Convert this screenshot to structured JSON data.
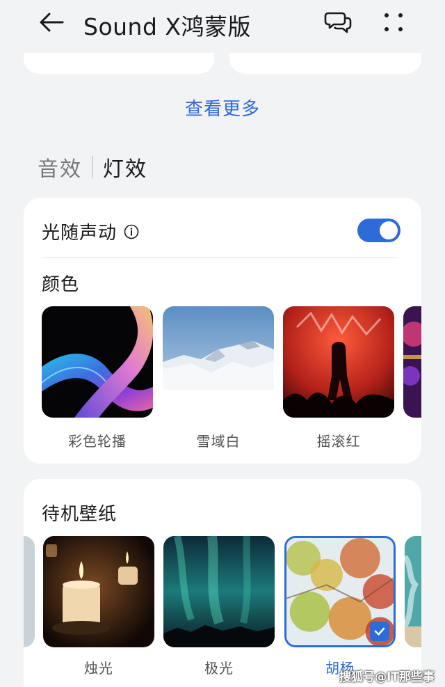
{
  "header": {
    "title": "Sound X鸿蒙版",
    "back_icon": "arrow-left-icon",
    "chat_icon": "chat-bubbles-icon",
    "more_icon": "more-dots-icon"
  },
  "see_more": "查看更多",
  "tabs": [
    {
      "label": "音效",
      "active": false
    },
    {
      "label": "灯效",
      "active": true
    }
  ],
  "light_card": {
    "toggle_label": "光随声动",
    "toggle_on": true,
    "color_label": "颜色",
    "colors": [
      {
        "label": "彩色轮播"
      },
      {
        "label": "雪域白"
      },
      {
        "label": "摇滚红"
      }
    ]
  },
  "standby_card": {
    "label": "待机壁纸",
    "wallpapers": [
      {
        "label": "烛光",
        "selected": false
      },
      {
        "label": "极光",
        "selected": false
      },
      {
        "label": "胡杨",
        "selected": true
      }
    ]
  },
  "watermark": "搜狐号@IT那些事儿",
  "colors": {
    "accent": "#2d6bd9",
    "background": "#f1f3f5",
    "card": "#ffffff"
  }
}
